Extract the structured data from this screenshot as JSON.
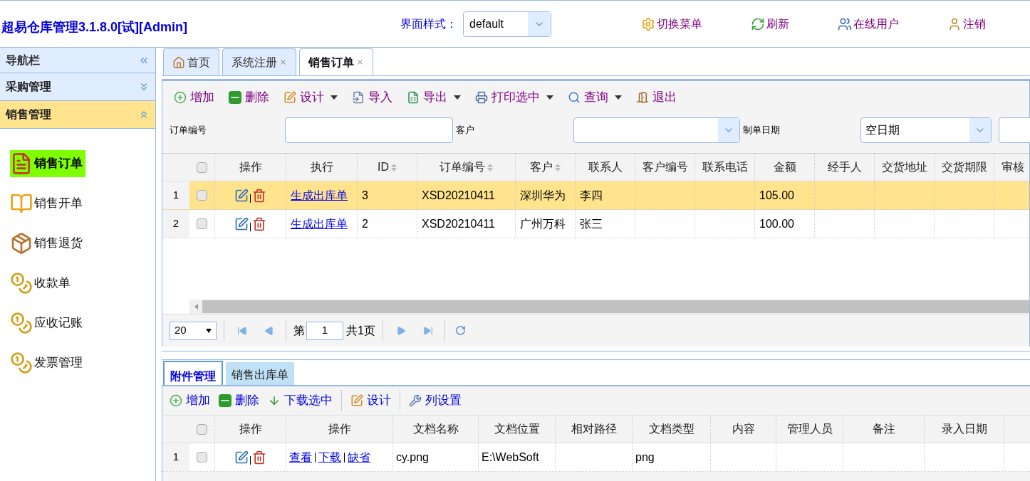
{
  "header": {
    "title": "超易仓库管理3.1.8.0[试][Admin]",
    "style_label": "界面样式：",
    "style_value": "default",
    "actions": [
      {
        "kind": "gear",
        "label": "切换菜单"
      },
      {
        "kind": "refresh",
        "label": "刷新"
      },
      {
        "kind": "users",
        "label": "在线用户"
      },
      {
        "kind": "person",
        "label": "注销"
      }
    ]
  },
  "sidebar": {
    "title": "导航栏",
    "groups": [
      {
        "label": "采购管理",
        "expanded": false
      },
      {
        "label": "销售管理",
        "expanded": true
      }
    ],
    "items": [
      {
        "kind": "doc",
        "label": "销售订单",
        "selected": true
      },
      {
        "kind": "book",
        "label": "销售开单",
        "selected": false
      },
      {
        "kind": "box",
        "label": "销售退货",
        "selected": false
      },
      {
        "kind": "money",
        "label": "收款单",
        "selected": false
      },
      {
        "kind": "money",
        "label": "应收记账",
        "selected": false
      },
      {
        "kind": "money",
        "label": "发票管理",
        "selected": false
      }
    ]
  },
  "tabs": [
    {
      "kind": "home",
      "label": "首页",
      "closable": false,
      "selected": false
    },
    {
      "kind": "plain",
      "label": "系统注册",
      "closable": true,
      "selected": false
    },
    {
      "kind": "plain",
      "label": "销售订单",
      "closable": true,
      "selected": true
    }
  ],
  "toolbar": [
    {
      "kind": "add",
      "label": "增加",
      "dropdown": false
    },
    {
      "kind": "delete",
      "label": "删除",
      "dropdown": false
    },
    {
      "kind": "design",
      "label": "设计",
      "dropdown": true
    },
    {
      "kind": "import",
      "label": "导入",
      "dropdown": false
    },
    {
      "kind": "export",
      "label": "导出",
      "dropdown": true
    },
    {
      "kind": "print",
      "label": "打印选中",
      "dropdown": true
    },
    {
      "kind": "search",
      "label": "查询",
      "dropdown": true
    },
    {
      "kind": "exit",
      "label": "退出",
      "dropdown": false
    }
  ],
  "filters": [
    {
      "kind": "text",
      "label": "订单编号"
    },
    {
      "kind": "select",
      "label": "客户"
    },
    {
      "kind": "select",
      "label": "制单日期",
      "value": "空日期"
    },
    {
      "kind": "text"
    }
  ],
  "grid": {
    "columns": [
      {
        "kind": "actions",
        "label": "操作"
      },
      {
        "kind": "link",
        "label": "执行"
      },
      {
        "kind": "field",
        "label": "ID",
        "sortable": true
      },
      {
        "kind": "field",
        "label": "订单编号",
        "sortable": true
      },
      {
        "kind": "field",
        "label": "客户",
        "sortable": true
      },
      {
        "kind": "field",
        "label": "联系人",
        "sortable": false
      },
      {
        "kind": "field",
        "label": "客户编号",
        "sortable": false
      },
      {
        "kind": "field",
        "label": "联系电话",
        "sortable": false
      },
      {
        "kind": "field",
        "label": "金额",
        "sortable": false
      },
      {
        "kind": "field",
        "label": "经手人",
        "sortable": false
      },
      {
        "kind": "field",
        "label": "交货地址",
        "sortable": false
      },
      {
        "kind": "field",
        "label": "交货期限",
        "sortable": false
      },
      {
        "kind": "field",
        "label": "审核",
        "sortable": false
      }
    ],
    "header_checked": false,
    "rows": [
      {
        "number": "1",
        "selected": true,
        "checked": false,
        "link": "生成出库单",
        "id": "3",
        "order_no": "XSD20210411",
        "customer": "深圳华为",
        "contact": "李四",
        "amount": "105.00"
      },
      {
        "number": "2",
        "selected": false,
        "checked": false,
        "link": "生成出库单",
        "id": "2",
        "order_no": "XSD20210411",
        "customer": "广州万科",
        "contact": "张三",
        "amount": "100.00"
      }
    ]
  },
  "pager": {
    "page_size": "20",
    "before": "第",
    "page": "1",
    "after": "共1页"
  },
  "bottom_tabs": [
    {
      "label": "附件管理",
      "selected": true
    },
    {
      "label": "销售出库单",
      "selected": false
    }
  ],
  "bottom_toolbar": [
    {
      "kind": "add",
      "label": "增加"
    },
    {
      "kind": "delete",
      "label": "删除"
    },
    {
      "kind": "download",
      "label": "下载选中"
    },
    {
      "kind": "design",
      "label": "设计"
    },
    {
      "kind": "wrench",
      "label": "列设置"
    }
  ],
  "attachments": {
    "columns": [
      {
        "kind": "actions",
        "label": "操作"
      },
      {
        "kind": "links",
        "label": "操作"
      },
      {
        "kind": "field",
        "label": "文档名称"
      },
      {
        "kind": "field",
        "label": "文档位置"
      },
      {
        "kind": "field",
        "label": "相对路径"
      },
      {
        "kind": "field",
        "label": "文档类型"
      },
      {
        "kind": "field",
        "label": "内容"
      },
      {
        "kind": "field",
        "label": "管理人员"
      },
      {
        "kind": "field",
        "label": "备注"
      },
      {
        "kind": "field",
        "label": "录入日期"
      }
    ],
    "header_checked": false,
    "rows": [
      {
        "number": "1",
        "checked": false,
        "links": [
          "查看",
          "下载",
          "缺省"
        ],
        "name": "cy.png",
        "location": "E:\\WebSoft",
        "type": "png"
      }
    ]
  }
}
